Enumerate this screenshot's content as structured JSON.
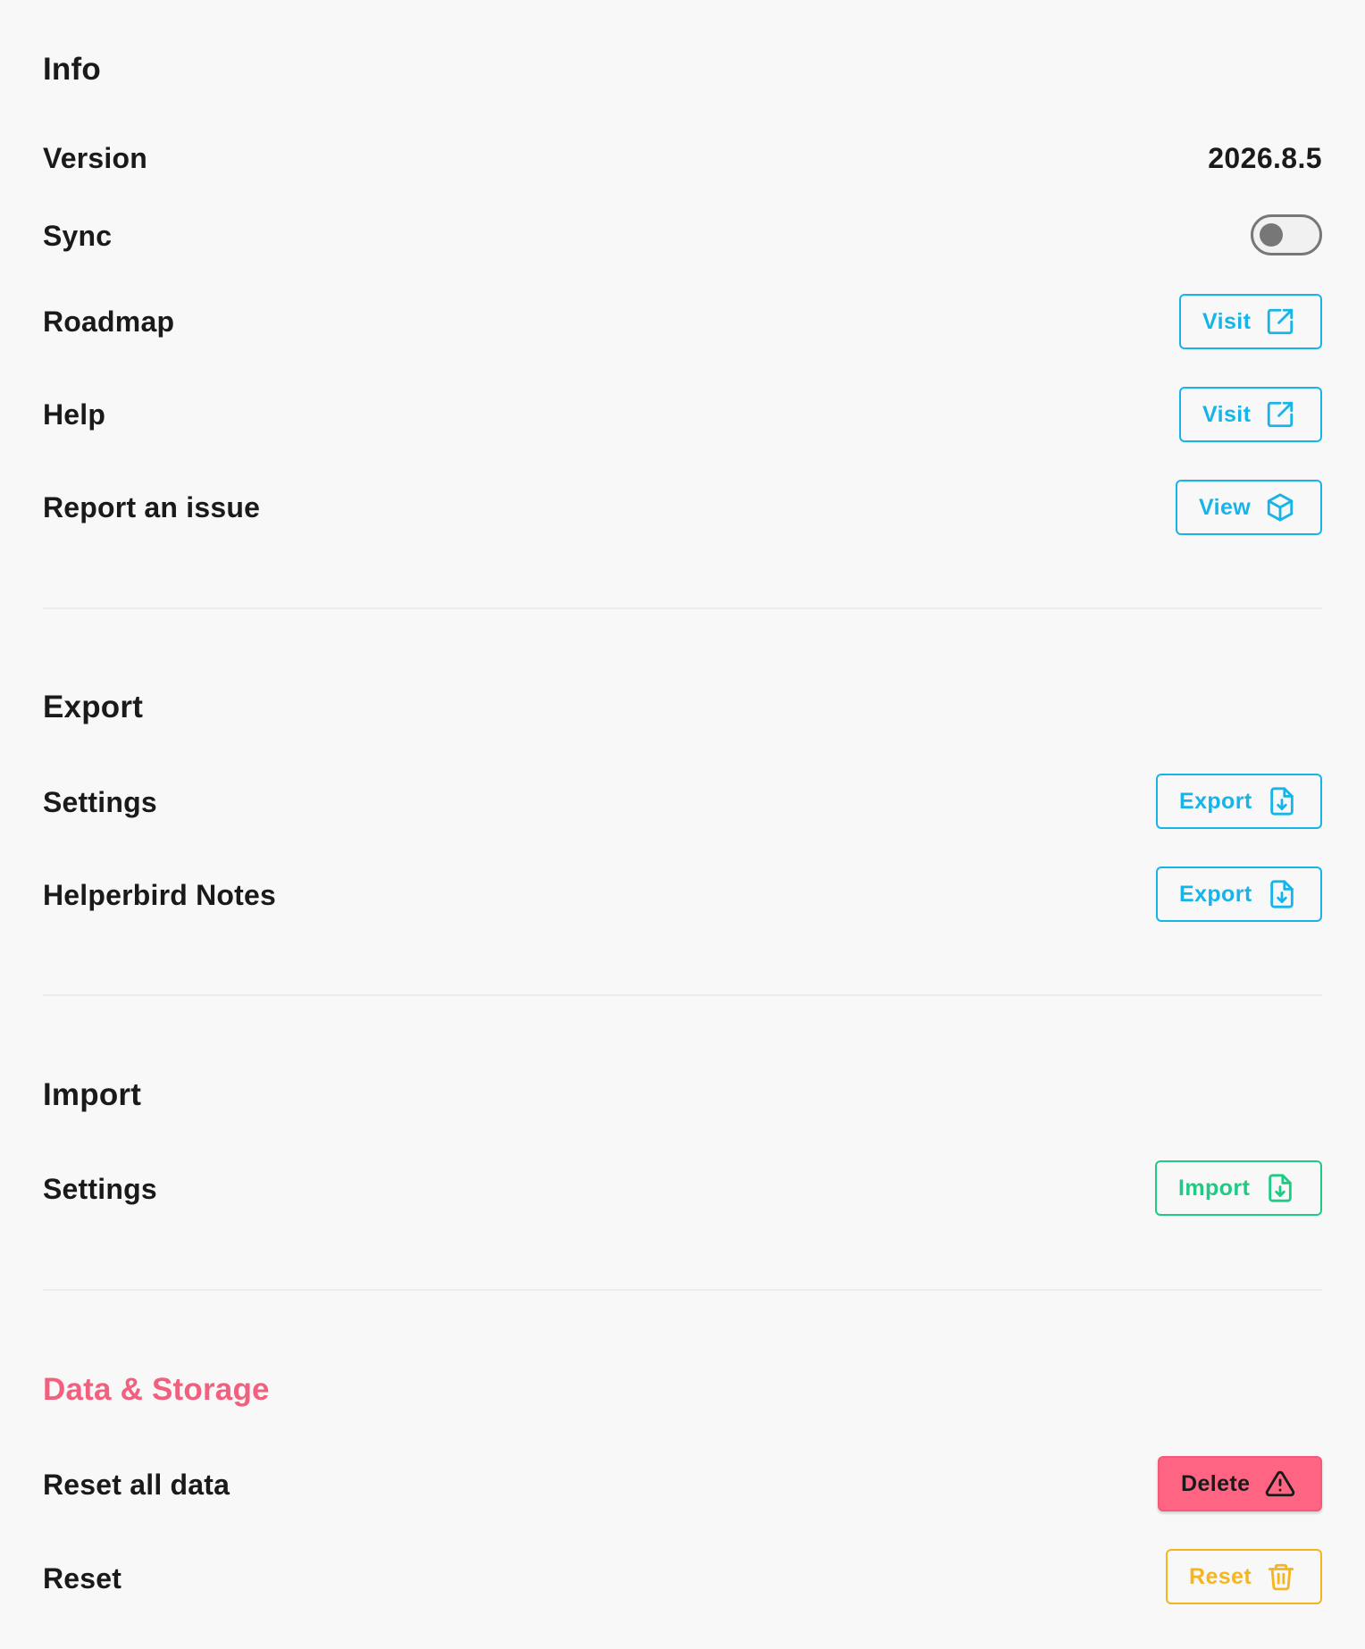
{
  "info": {
    "title": "Info",
    "version_label": "Version",
    "version_value": "2026.8.5",
    "sync_label": "Sync",
    "sync_enabled": false,
    "roadmap_label": "Roadmap",
    "roadmap_button": "Visit",
    "help_label": "Help",
    "help_button": "Visit",
    "report_label": "Report an issue",
    "report_button": "View"
  },
  "export": {
    "title": "Export",
    "settings_label": "Settings",
    "settings_button": "Export",
    "notes_label": "Helperbird Notes",
    "notes_button": "Export"
  },
  "import": {
    "title": "Import",
    "settings_label": "Settings",
    "settings_button": "Import"
  },
  "data_storage": {
    "title": "Data & Storage",
    "reset_all_label": "Reset all data",
    "reset_all_button": "Delete",
    "reset_label": "Reset",
    "reset_button": "Reset"
  },
  "colors": {
    "accent_blue": "#16b4e8",
    "accent_green": "#1ecb85",
    "danger_pink": "#ff6583",
    "warning_yellow": "#f6b51c",
    "section_danger_title": "#f1607e"
  },
  "icons": {
    "visit": "external-link-icon",
    "view": "cube-icon",
    "export": "file-download-icon",
    "import": "file-download-icon",
    "delete": "warning-triangle-icon",
    "reset": "trash-icon"
  }
}
